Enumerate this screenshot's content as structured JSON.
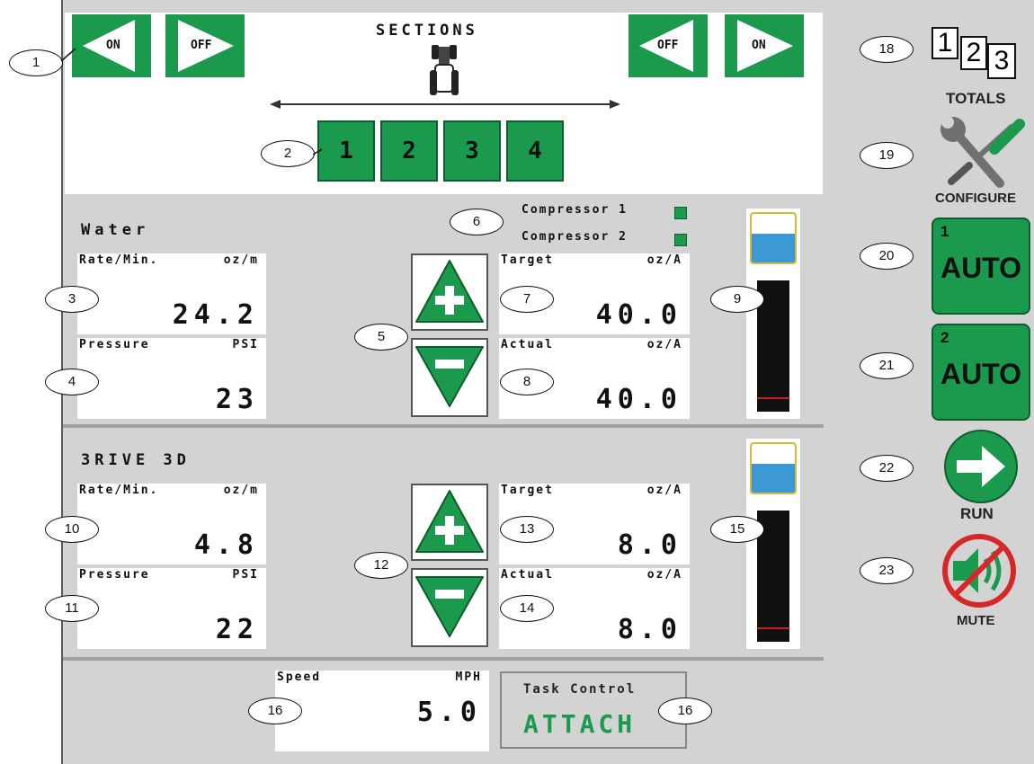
{
  "sections": {
    "title": "SECTIONS",
    "left_on": "ON",
    "left_off": "OFF",
    "right_off": "OFF",
    "right_on": "ON",
    "boxes": [
      "1",
      "2",
      "3",
      "4"
    ]
  },
  "products": [
    {
      "name": "Water",
      "rate_label": "Rate/Min.",
      "rate_unit": "oz/m",
      "rate_value": "24.2",
      "pressure_label": "Pressure",
      "pressure_unit": "PSI",
      "pressure_value": "23",
      "target_label": "Target",
      "target_unit": "oz/A",
      "target_value": "40.0",
      "actual_label": "Actual",
      "actual_unit": "oz/A",
      "actual_value": "40.0"
    },
    {
      "name": "3RIVE 3D",
      "rate_label": "Rate/Min.",
      "rate_unit": "oz/m",
      "rate_value": "4.8",
      "pressure_label": "Pressure",
      "pressure_unit": "PSI",
      "pressure_value": "22",
      "target_label": "Target",
      "target_unit": "oz/A",
      "target_value": "8.0",
      "actual_label": "Actual",
      "actual_unit": "oz/A",
      "actual_value": "8.0"
    }
  ],
  "compressors": [
    "Compressor 1",
    "Compressor 2"
  ],
  "speed": {
    "label": "Speed",
    "unit": "MPH",
    "value": "5.0"
  },
  "task_control": {
    "label": "Task Control",
    "value": "ATTACH"
  },
  "sidebar": {
    "totals_digits": [
      "1",
      "2",
      "3"
    ],
    "totals_label": "TOTALS",
    "configure_label": "CONFIGURE",
    "auto1_num": "1",
    "auto1_label": "AUTO",
    "auto2_num": "2",
    "auto2_label": "AUTO",
    "run_label": "RUN",
    "mute_label": "MUTE"
  },
  "callouts": [
    "1",
    "2",
    "3",
    "4",
    "5",
    "6",
    "7",
    "8",
    "9",
    "10",
    "11",
    "12",
    "13",
    "14",
    "15",
    "16",
    "16",
    "18",
    "19",
    "20",
    "21",
    "22",
    "23"
  ],
  "colors": {
    "button_green": "#1b9a4e",
    "screen_gray": "#d3d3d3",
    "tank_blue": "#3c99d4",
    "tank_border": "#d4b93a",
    "level_mark": "#c81e1e"
  }
}
